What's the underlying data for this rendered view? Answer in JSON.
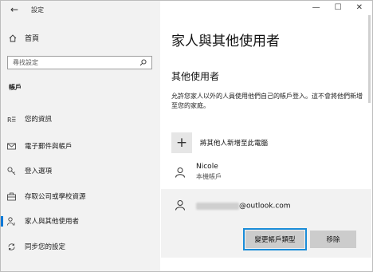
{
  "window": {
    "title": "設定",
    "controls": [
      "—",
      "☐",
      "✕"
    ]
  },
  "sidebar": {
    "home_label": "首頁",
    "search_placeholder": "尋找設定",
    "section_label": "帳戶",
    "items": [
      {
        "label": "您的資訊",
        "icon": "person-card-icon"
      },
      {
        "label": "電子郵件與帳戶",
        "icon": "mail-icon"
      },
      {
        "label": "登入選項",
        "icon": "key-icon"
      },
      {
        "label": "存取公司或學校資源",
        "icon": "briefcase-icon"
      },
      {
        "label": "家人與其他使用者",
        "icon": "people-icon",
        "selected": true
      },
      {
        "label": "同步您的設定",
        "icon": "sync-icon"
      }
    ]
  },
  "main": {
    "title": "家人與其他使用者",
    "subheading": "其他使用者",
    "description": "允許您家人以外的人員使用他們自己的帳戶登入。這不會將他們新增至您的家庭。",
    "add_label": "將其他人新增至此電腦",
    "users": [
      {
        "name": "Nicole",
        "sub": "本機帳戶"
      },
      {
        "email_suffix": "@outlook.com"
      }
    ],
    "buttons": {
      "change_type": "變更帳戶類型",
      "remove": "移除"
    }
  },
  "colors": {
    "accent": "#0078d7",
    "sidebar_bg": "#f2f2f2",
    "button_bg": "#cccccc"
  }
}
